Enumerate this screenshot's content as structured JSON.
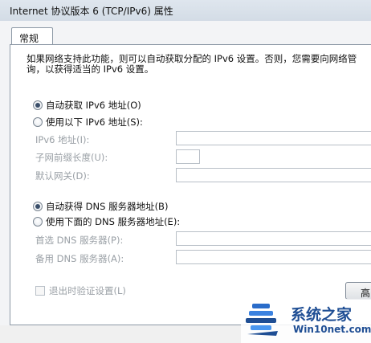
{
  "window": {
    "title": "Internet 协议版本 6 (TCP/IPv6) 属性"
  },
  "tabs": [
    {
      "label": "常规"
    }
  ],
  "description": {
    "line1": "如果网络支持此功能，则可以自动获取分配的 IPv6 设置。否则，您需要向网络管",
    "line2": "询，以获得适当的 IPv6 设置。"
  },
  "ip_section": {
    "auto_label": "自动获取 IPv6 地址(O)",
    "manual_label": "使用以下 IPv6 地址(S):",
    "selected": "auto",
    "fields": [
      {
        "label": "IPv6 地址(I):",
        "value": ""
      },
      {
        "label": "子网前缀长度(U):",
        "value": ""
      },
      {
        "label": "默认网关(D):",
        "value": ""
      }
    ]
  },
  "dns_section": {
    "auto_label": "自动获得 DNS 服务器地址(B)",
    "manual_label": "使用下面的 DNS 服务器地址(E):",
    "selected": "auto",
    "fields": [
      {
        "label": "首选 DNS 服务器(P):",
        "value": ""
      },
      {
        "label": "备用 DNS 服务器(A):",
        "value": ""
      }
    ]
  },
  "validate": {
    "label": "退出时验证设置(L)",
    "checked": false
  },
  "buttons": {
    "advanced_label": "高"
  },
  "watermark": {
    "brand": "系统之家",
    "url": "Win10net.com"
  },
  "colors": {
    "brand_blue": "#1f4e94",
    "disabled_text": "#9aa0a6"
  }
}
